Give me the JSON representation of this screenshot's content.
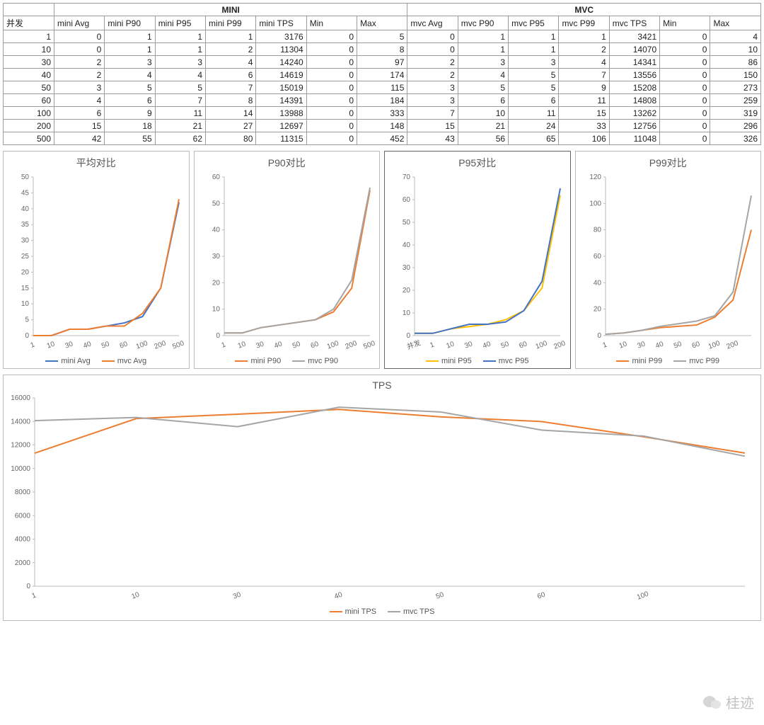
{
  "colors": {
    "orange": "#ED7D31",
    "blue": "#4472C4",
    "gray": "#A5A5A5",
    "yellow": "#FFC000"
  },
  "table": {
    "group_headers": [
      "",
      "MINI",
      "MVC"
    ],
    "headers": [
      "并发",
      "mini Avg",
      "mini P90",
      "mini P95",
      "mini P99",
      "mini TPS",
      "Min",
      "Max",
      "mvc Avg",
      "mvc P90",
      "mvc P95",
      "mvc P99",
      "mvc TPS",
      "Min",
      "Max"
    ],
    "rows": [
      [
        1,
        0,
        1,
        1,
        1,
        3176,
        0,
        5,
        0,
        1,
        1,
        1,
        3421,
        0,
        4
      ],
      [
        10,
        0,
        1,
        1,
        2,
        11304,
        0,
        8,
        0,
        1,
        1,
        2,
        14070,
        0,
        10
      ],
      [
        30,
        2,
        3,
        3,
        4,
        14240,
        0,
        97,
        2,
        3,
        3,
        4,
        14341,
        0,
        86
      ],
      [
        40,
        2,
        4,
        4,
        6,
        14619,
        0,
        174,
        2,
        4,
        5,
        7,
        13556,
        0,
        150
      ],
      [
        50,
        3,
        5,
        5,
        7,
        15019,
        0,
        115,
        3,
        5,
        5,
        9,
        15208,
        0,
        273
      ],
      [
        60,
        4,
        6,
        7,
        8,
        14391,
        0,
        184,
        3,
        6,
        6,
        11,
        14808,
        0,
        259
      ],
      [
        100,
        6,
        9,
        11,
        14,
        13988,
        0,
        333,
        7,
        10,
        11,
        15,
        13262,
        0,
        319
      ],
      [
        200,
        15,
        18,
        21,
        27,
        12697,
        0,
        148,
        15,
        21,
        24,
        33,
        12756,
        0,
        296
      ],
      [
        500,
        42,
        55,
        62,
        80,
        11315,
        0,
        452,
        43,
        56,
        65,
        106,
        11048,
        0,
        326
      ]
    ]
  },
  "watermark": "桂迹",
  "chart_data": [
    {
      "type": "line",
      "title": "平均对比",
      "categories": [
        1,
        10,
        30,
        40,
        50,
        60,
        100,
        200,
        500
      ],
      "series": [
        {
          "name": "mini Avg",
          "values": [
            0,
            0,
            2,
            2,
            3,
            4,
            6,
            15,
            42
          ],
          "color": "blue"
        },
        {
          "name": "mvc Avg",
          "values": [
            0,
            0,
            2,
            2,
            3,
            3,
            7,
            15,
            43
          ],
          "color": "orange"
        }
      ],
      "ylim": [
        0,
        50
      ],
      "ystep": 5
    },
    {
      "type": "line",
      "title": "P90对比",
      "categories": [
        1,
        10,
        30,
        40,
        50,
        60,
        100,
        200,
        500
      ],
      "series": [
        {
          "name": "mini P90",
          "values": [
            1,
            1,
            3,
            4,
            5,
            6,
            9,
            18,
            55
          ],
          "color": "orange"
        },
        {
          "name": "mvc P90",
          "values": [
            1,
            1,
            3,
            4,
            5,
            6,
            10,
            21,
            56
          ],
          "color": "gray"
        }
      ],
      "ylim": [
        0,
        60
      ],
      "ystep": 10
    },
    {
      "type": "line",
      "title": "P95对比",
      "categories": [
        "并发",
        1,
        10,
        30,
        40,
        50,
        60,
        100,
        200
      ],
      "series": [
        {
          "name": "mini P95",
          "values": [
            null,
            1,
            1,
            3,
            4,
            5,
            7,
            11,
            21,
            62
          ],
          "color": "yellow"
        },
        {
          "name": "mvc P95",
          "values": [
            null,
            1,
            1,
            3,
            5,
            5,
            6,
            11,
            24,
            65
          ],
          "color": "blue"
        }
      ],
      "ylim": [
        0,
        70
      ],
      "ystep": 10
    },
    {
      "type": "line",
      "title": "P99对比",
      "categories": [
        1,
        10,
        30,
        40,
        50,
        60,
        100,
        200
      ],
      "series": [
        {
          "name": "mini P99",
          "values": [
            1,
            2,
            4,
            6,
            7,
            8,
            14,
            27,
            80
          ],
          "color": "orange"
        },
        {
          "name": "mvc P99",
          "values": [
            1,
            2,
            4,
            7,
            9,
            11,
            15,
            33,
            106
          ],
          "color": "gray"
        }
      ],
      "ylim": [
        0,
        120
      ],
      "ystep": 20
    },
    {
      "type": "line",
      "title": "TPS",
      "categories": [
        1,
        10,
        30,
        40,
        50,
        60,
        100
      ],
      "series": [
        {
          "name": "mini TPS",
          "values": [
            11304,
            14240,
            14619,
            15019,
            14391,
            13988,
            12697,
            11315
          ],
          "color": "orange"
        },
        {
          "name": "mvc TPS",
          "values": [
            14070,
            14341,
            13556,
            15208,
            14808,
            13262,
            12756,
            11048
          ],
          "color": "gray"
        }
      ],
      "ylim": [
        0,
        16000
      ],
      "ystep": 2000
    }
  ]
}
